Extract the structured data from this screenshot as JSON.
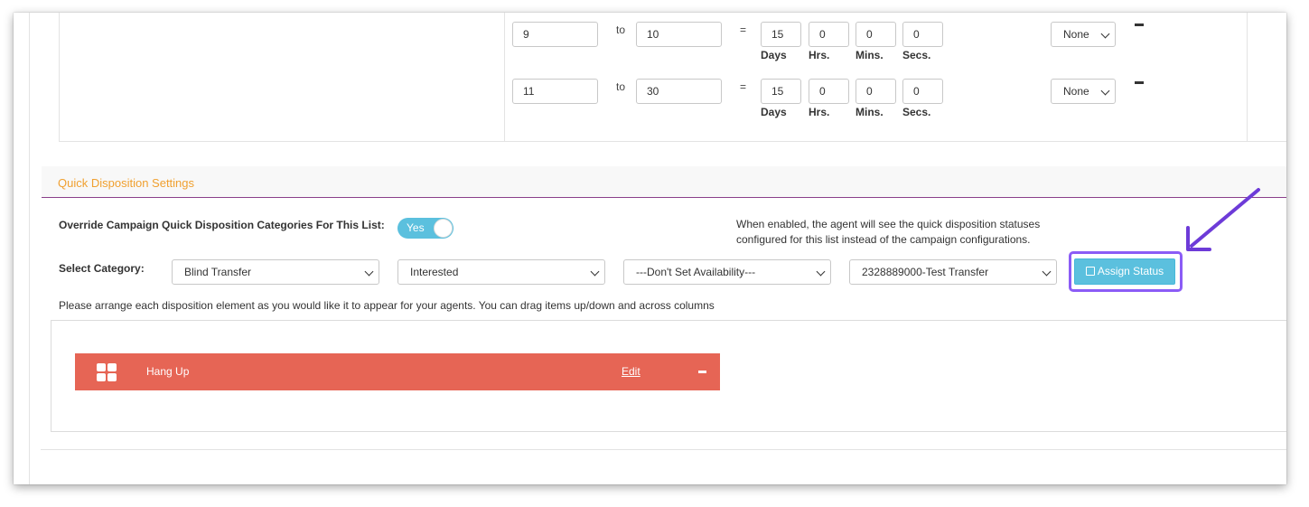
{
  "ranges": [
    {
      "from": "9",
      "to_word": "to",
      "to": "10",
      "eq": "=",
      "days": "15",
      "hrs": "0",
      "mins": "0",
      "secs": "0",
      "select": "None"
    },
    {
      "from": "11",
      "to_word": "to",
      "to": "30",
      "eq": "=",
      "days": "15",
      "hrs": "0",
      "mins": "0",
      "secs": "0",
      "select": "None"
    }
  ],
  "units": {
    "days": "Days",
    "hrs": "Hrs.",
    "mins": "Mins.",
    "secs": "Secs."
  },
  "section": {
    "title": "Quick Disposition Settings"
  },
  "override": {
    "label": "Override Campaign Quick Disposition Categories For This List:",
    "toggle": "Yes",
    "note_line1": "When enabled, the agent will see the quick disposition statuses",
    "note_line2": "configured for this list instead of the campaign configurations."
  },
  "category": {
    "label": "Select Category:",
    "select1": "Blind Transfer",
    "select2": "Interested",
    "select3": "---Don't Set Availability---",
    "select4": "2328889000-Test Transfer",
    "assign_button": "Assign Status"
  },
  "instructions": "Please arrange each disposition element as you would like it to appear for your agents. You can drag items up/down and across columns",
  "dispositions": [
    {
      "name": "Hang Up",
      "edit": "Edit"
    }
  ],
  "colors": {
    "accent": "#5bc0de",
    "title": "#f0a030",
    "dispo": "#e66555",
    "highlight": "#8b5cf6"
  }
}
